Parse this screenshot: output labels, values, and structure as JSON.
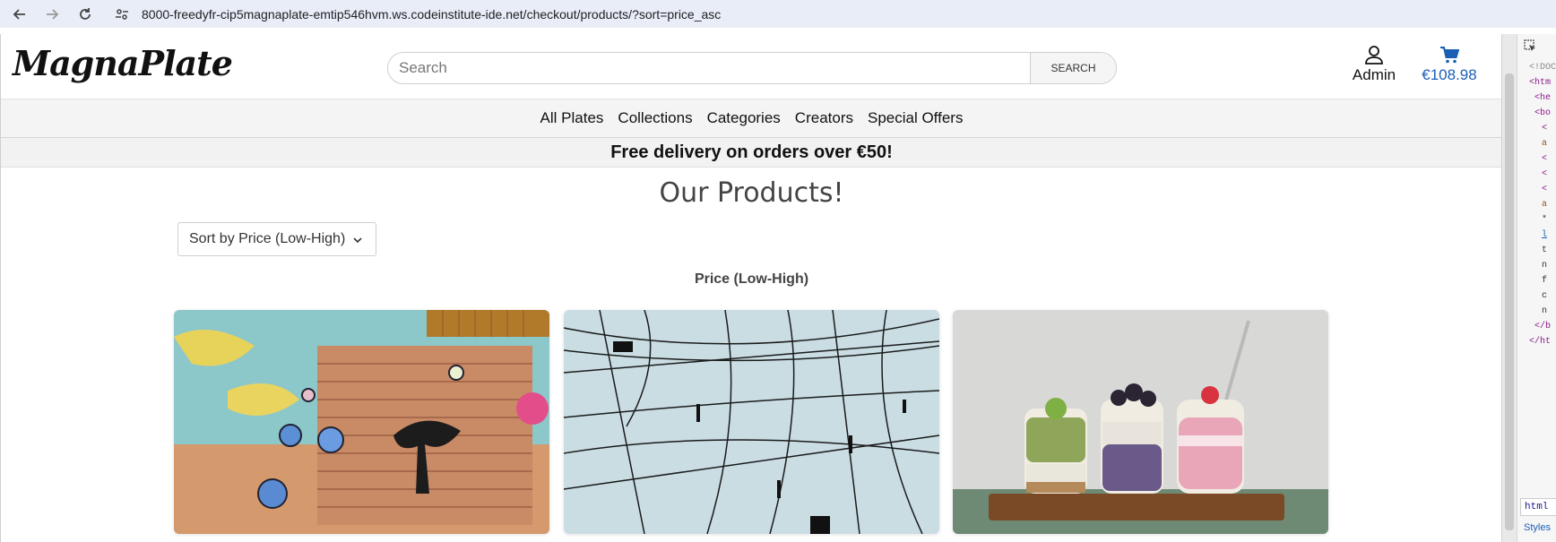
{
  "browser": {
    "url": "8000-freedyfr-cip5magnaplate-emtip546hvm.ws.codeinstitute-ide.net/checkout/products/?sort=price_asc"
  },
  "header": {
    "logo": "MagnaPlate",
    "search_placeholder": "Search",
    "search_button": "SEARCH",
    "account_label": "Admin",
    "cart_total": "€108.98"
  },
  "nav": {
    "items": [
      "All Plates",
      "Collections",
      "Categories",
      "Creators",
      "Special Offers"
    ]
  },
  "banner": "Free delivery on orders over €50!",
  "main": {
    "title": "Our Products!",
    "sort_selected": "Sort by Price (Low-High)",
    "sort_label": "Price (Low-High)"
  },
  "devtools": {
    "lines": [
      "<!DOC",
      "<htm",
      "<he",
      "<bo",
      "<",
      "a",
      "<",
      "<",
      "<",
      "a",
      "*",
      "l",
      "t",
      "n",
      "f",
      "c",
      "n",
      "</b",
      "</ht"
    ],
    "tab": "html",
    "panel": "Styles"
  },
  "colors": {
    "accent": "#1a5fb4",
    "banner_bg": "#f2f2f2",
    "chrome_bg": "#e8edf7"
  }
}
